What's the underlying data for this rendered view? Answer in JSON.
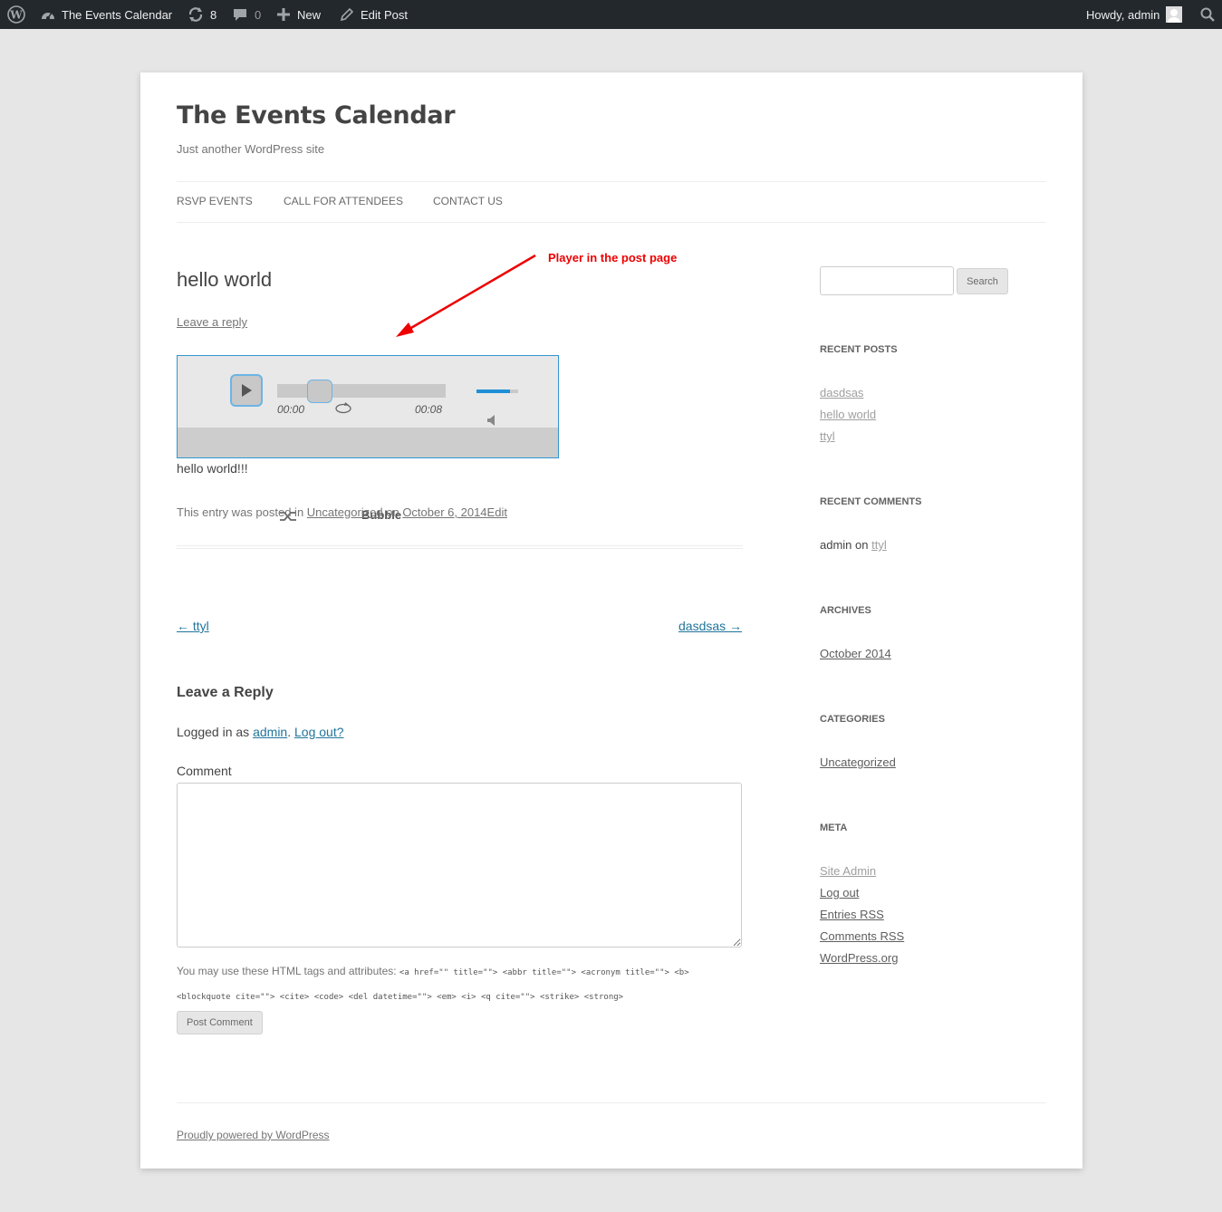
{
  "admin_bar": {
    "site_name": "The Events Calendar",
    "updates_count": "8",
    "comments_count": "0",
    "new_label": "New",
    "edit_label": "Edit Post",
    "howdy": "Howdy, admin"
  },
  "header": {
    "site_title": "The Events Calendar",
    "tagline": "Just another WordPress site",
    "nav": [
      "RSVP EVENTS",
      "CALL FOR ATTENDEES",
      "CONTACT US"
    ]
  },
  "annotation": "Player in the post page",
  "post": {
    "title": "hello world",
    "leave_reply": "Leave a reply",
    "body": "hello world!!!",
    "meta_prefix": "This entry was posted in ",
    "category": "Uncategorized",
    "meta_on": " on ",
    "date": "October 6, 2014",
    "edit": "Edit"
  },
  "player": {
    "current_time": "00:00",
    "duration": "00:08",
    "track_name": "Bubble",
    "progress_fraction": 0.25,
    "volume_fraction": 0.8,
    "accent": "#1e8fd6"
  },
  "post_nav": {
    "prev": "← ttyl",
    "next": "dasdsas →"
  },
  "reply": {
    "title": "Leave a Reply",
    "logged_in_prefix": "Logged in as ",
    "user": "admin",
    "logout": "Log out?",
    "comment_label": "Comment",
    "allowed_prefix": "You may use these HTML tags and attributes: ",
    "allowed_tags_1": "<a href=\"\" title=\"\"> <abbr title=\"\"> <acronym title=\"\"> <b>",
    "allowed_tags_2": "<blockquote cite=\"\"> <cite> <code> <del datetime=\"\"> <em> <i> <q cite=\"\"> <strike> <strong>",
    "submit": "Post Comment"
  },
  "sidebar": {
    "search_button": "Search",
    "recent_posts_title": "RECENT POSTS",
    "recent_posts": [
      "dasdsas",
      "hello world",
      "ttyl"
    ],
    "recent_comments_title": "RECENT COMMENTS",
    "recent_comment_author": "admin",
    "recent_comment_on": " on ",
    "recent_comment_post": "ttyl",
    "archives_title": "ARCHIVES",
    "archives": [
      "October 2014"
    ],
    "categories_title": "CATEGORIES",
    "categories": [
      "Uncategorized"
    ],
    "meta_title": "META",
    "meta_links": [
      "Site Admin",
      "Log out",
      "Entries RSS",
      "Comments RSS",
      "WordPress.org"
    ]
  },
  "footer": {
    "powered": "Proudly powered by WordPress"
  }
}
